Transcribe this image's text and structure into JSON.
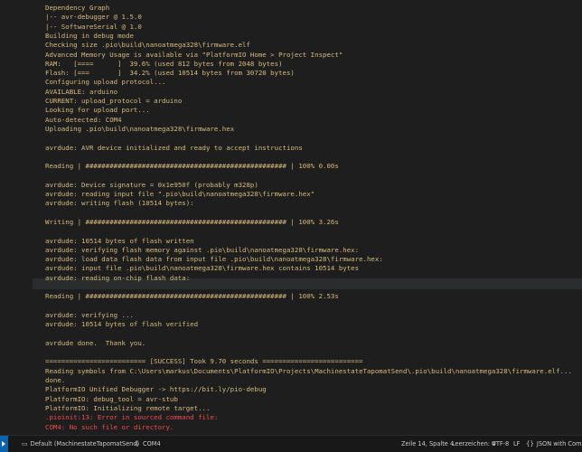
{
  "terminal": {
    "lines": [
      {
        "text": "Dependency Graph",
        "color": "yellow"
      },
      {
        "text": "|-- avr-debugger @ 1.5.0",
        "color": "yellow"
      },
      {
        "text": "|-- SoftwareSerial @ 1.0",
        "color": "yellow"
      },
      {
        "text": "Building in debug mode",
        "color": "yellow"
      },
      {
        "text": "Checking size .pio\\build\\nanoatmega328\\firmware.elf",
        "color": "yellow"
      },
      {
        "text": "Advanced Memory Usage is available via \"PlatformIO Home > Project Inspect\"",
        "color": "yellow"
      },
      {
        "text": "RAM:   [====      ]  39.6% (used 812 bytes from 2048 bytes)",
        "color": "yellow"
      },
      {
        "text": "Flash: [===       ]  34.2% (used 10514 bytes from 30720 bytes)",
        "color": "yellow"
      },
      {
        "text": "Configuring upload protocol...",
        "color": "yellow"
      },
      {
        "text": "AVAILABLE: arduino",
        "color": "yellow"
      },
      {
        "text": "CURRENT: upload_protocol = arduino",
        "color": "yellow"
      },
      {
        "text": "Looking for upload port...",
        "color": "yellow"
      },
      {
        "text": "Auto-detected: COM4",
        "color": "yellow"
      },
      {
        "text": "Uploading .pio\\build\\nanoatmega328\\firmware.hex",
        "color": "yellow"
      },
      {
        "text": "",
        "color": "yellow"
      },
      {
        "text": "avrdude: AVR device initialized and ready to accept instructions",
        "color": "yellow"
      },
      {
        "text": "",
        "color": "yellow"
      },
      {
        "text": "Reading | ################################################## | 100% 0.00s",
        "color": "yellow"
      },
      {
        "text": "",
        "color": "yellow"
      },
      {
        "text": "avrdude: Device signature = 0x1e950f (probably m328p)",
        "color": "yellow"
      },
      {
        "text": "avrdude: reading input file \".pio\\build\\nanoatmega328\\firmware.hex\"",
        "color": "yellow"
      },
      {
        "text": "avrdude: writing flash (10514 bytes):",
        "color": "yellow"
      },
      {
        "text": "",
        "color": "yellow"
      },
      {
        "text": "Writing | ################################################## | 100% 3.26s",
        "color": "yellow"
      },
      {
        "text": "",
        "color": "yellow"
      },
      {
        "text": "avrdude: 10514 bytes of flash written",
        "color": "yellow"
      },
      {
        "text": "avrdude: verifying flash memory against .pio\\build\\nanoatmega328\\firmware.hex:",
        "color": "yellow"
      },
      {
        "text": "avrdude: load data flash data from input file .pio\\build\\nanoatmega328\\firmware.hex:",
        "color": "yellow"
      },
      {
        "text": "avrdude: input file .pio\\build\\nanoatmega328\\firmware.hex contains 10514 bytes",
        "color": "yellow"
      },
      {
        "text": "avrdude: reading on-chip flash data:",
        "color": "yellow"
      },
      {
        "text": "",
        "color": "yellow"
      },
      {
        "text": "Reading | ################################################## | 100% 2.53s",
        "color": "yellow"
      },
      {
        "text": "",
        "color": "yellow"
      },
      {
        "text": "avrdude: verifying ...",
        "color": "yellow"
      },
      {
        "text": "avrdude: 10514 bytes of flash verified",
        "color": "yellow"
      },
      {
        "text": "",
        "color": "yellow"
      },
      {
        "text": "avrdude done.  Thank you.",
        "color": "yellow"
      },
      {
        "text": "",
        "color": "yellow"
      },
      {
        "text": "========================= [SUCCESS] Took 9.70 seconds =========================",
        "color": "yellow"
      },
      {
        "text": "Reading symbols from C:\\Users\\markus\\Documents\\PlatformIO\\Projects\\MachinestateTapomatSend\\.pio\\build\\nanoatmega328\\firmware.elf...",
        "color": "yellow"
      },
      {
        "text": "done.",
        "color": "yellow"
      },
      {
        "text": "PlatformIO Unified Debugger -> https://bit.ly/pio-debug",
        "color": "yellow"
      },
      {
        "text": "PlatformIO: debug_tool = avr-stub",
        "color": "yellow"
      },
      {
        "text": "PlatformIO: Initializing remote target...",
        "color": "yellow"
      },
      {
        "text": ".pioinit:13: Error in sourced command file:",
        "color": "red"
      },
      {
        "text": "COM4: No such file or directory.",
        "color": "red"
      }
    ]
  },
  "statusbar": {
    "project": "Default (MachinestateTapomatSend)",
    "port": "COM4",
    "position": "Zeile 14, Spalte 4",
    "indent": "Leerzeichen: 4",
    "encoding": "UTF-8",
    "eol": "LF",
    "language": "JSON with Commen",
    "icons": {
      "project": "folder-icon",
      "port": "plug-icon",
      "language": "braces-icon"
    }
  },
  "colors": {
    "background": "#1e1e1e",
    "text_yellow": "#d7ba7d",
    "text_red": "#f14c4c"
  }
}
